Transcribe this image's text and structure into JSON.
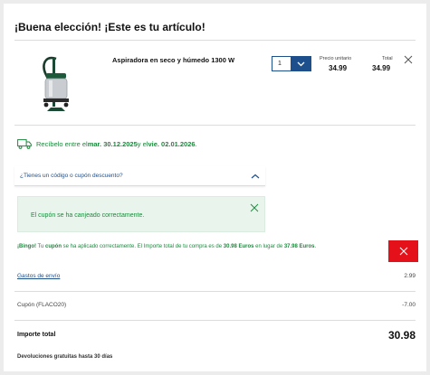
{
  "header": {
    "title": "¡Buena elección! ¡Este es tu artículo!"
  },
  "product": {
    "name": "Aspiradora en seco y húmedo 1300 W",
    "image_icon": "wet-dry-vacuum-image",
    "quantity": "1",
    "unit_price_label": "Precio unitario",
    "unit_price": "34.99",
    "total_label": "Total",
    "total": "34.99"
  },
  "delivery": {
    "prefix": "Recíbelo entre el ",
    "date_from": "mar. 30.12.2025",
    "middle": " y el ",
    "date_to": "vie. 02.01.2026",
    "suffix": "."
  },
  "coupon": {
    "question": "¿Tienes un código o cupón descuento?",
    "success_message": "El cupón se ha canjeado correctamente."
  },
  "bingo": {
    "lead": "¡Bingo!",
    "t1": " Tu ",
    "word": "cupón",
    "t2": " se ha aplicado correctamente. El Importe total de tu compra es de ",
    "new_total": "30.98 Euros",
    "t3": " en lugar de ",
    "old_total": "37.98 Euros",
    "t4": "."
  },
  "summary": {
    "shipping_label": "Gastos de envío",
    "shipping_value": "2.99",
    "coupon_label": "Cupón (FLACO20)",
    "coupon_value": "-7.00",
    "total_label": "Importe total",
    "total_value": "30.98",
    "returns_note": "Devoluciones gratuitas hasta 30 días"
  },
  "colors": {
    "brand_blue": "#1c4f8c",
    "success_green": "#1a8a3c",
    "success_bg": "#e9f5ec",
    "danger_red": "#e5111a"
  }
}
